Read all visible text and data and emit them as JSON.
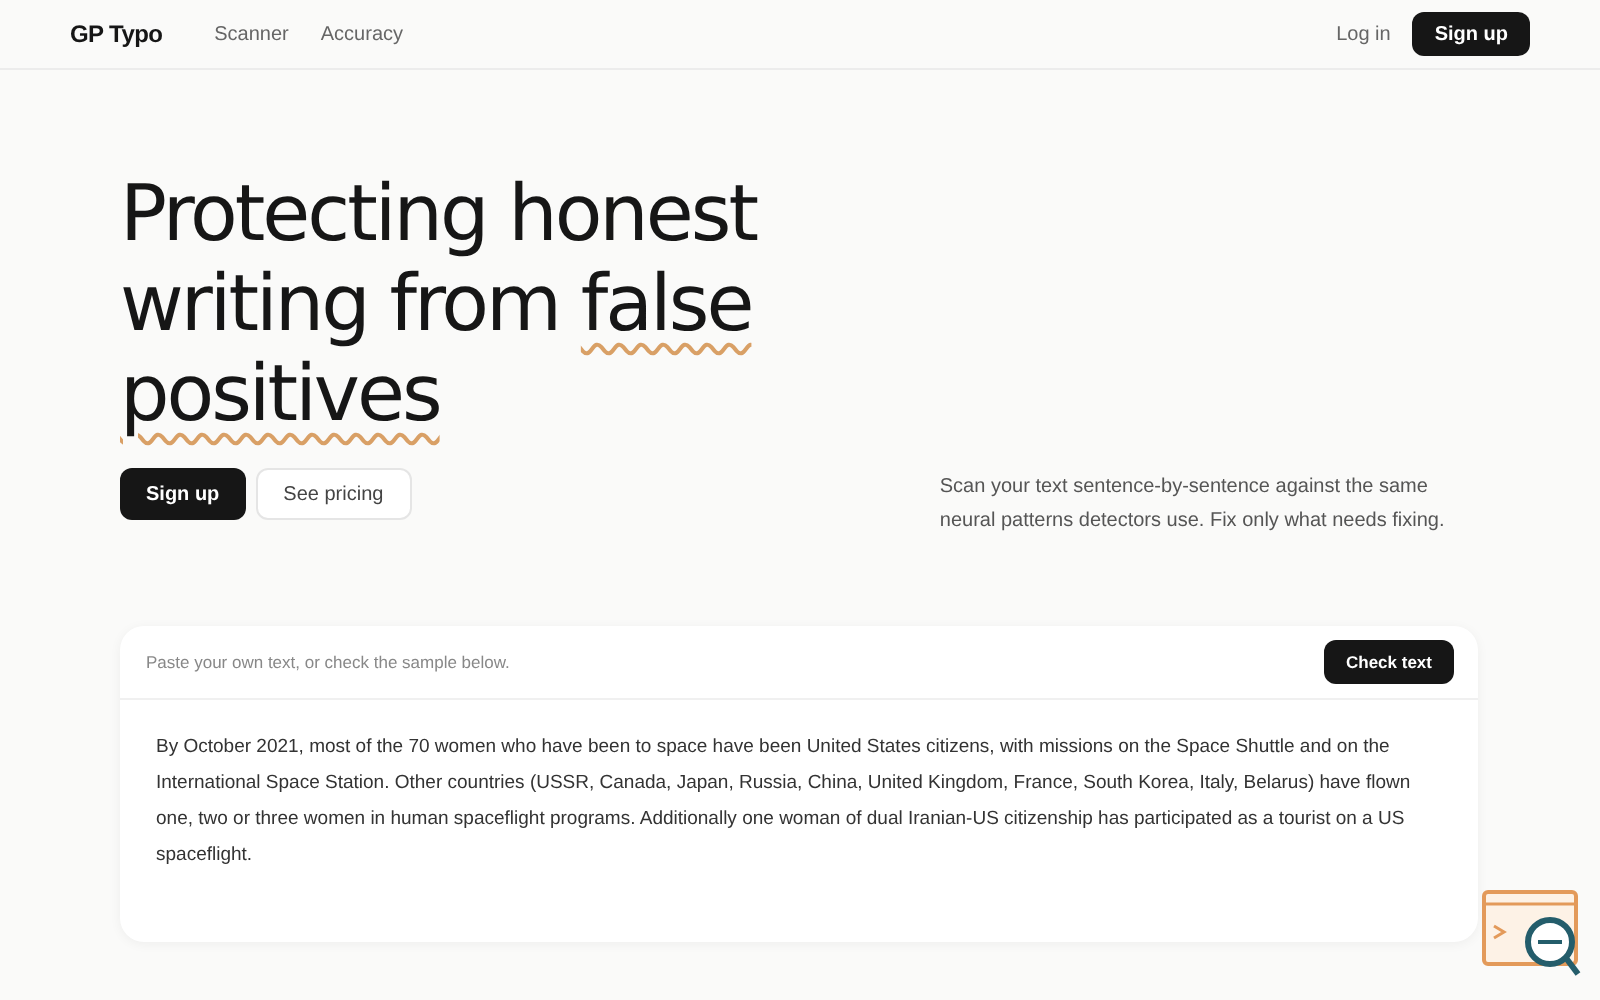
{
  "nav": {
    "logo": "GP Typo",
    "links": [
      "Scanner",
      "Accuracy"
    ],
    "login": "Log in",
    "signup": "Sign up"
  },
  "hero": {
    "headline_lines": [
      [
        {
          "text": "Protecting honest",
          "underlined": false
        }
      ],
      [
        {
          "text": "writing from ",
          "underlined": false
        },
        {
          "text": "false",
          "underlined": true
        }
      ],
      [
        {
          "text": "positives",
          "underlined": true
        }
      ]
    ],
    "buttons": [
      {
        "label": "Sign up",
        "kind": "primary"
      },
      {
        "label": "See pricing",
        "kind": "secondary"
      }
    ],
    "description": "Scan your text sentence-by-sentence against the same neural patterns detectors use. Fix only what needs fixing."
  },
  "checker": {
    "placeholder": "Paste your own text, or check the sample below.",
    "button": "Check text",
    "sample": "By October 2021, most of the 70 women who have been to space have been United States citizens, with missions on the Space Shuttle and on the International Space Station. Other countries (USSR, Canada, Japan, Russia, China, United Kingdom, France, South Korea, Italy, Belarus) have flown one, two or three women in human spaceflight programs. Additionally one woman of dual Iranian-US citizenship has participated as a tourist on a US spaceflight."
  }
}
